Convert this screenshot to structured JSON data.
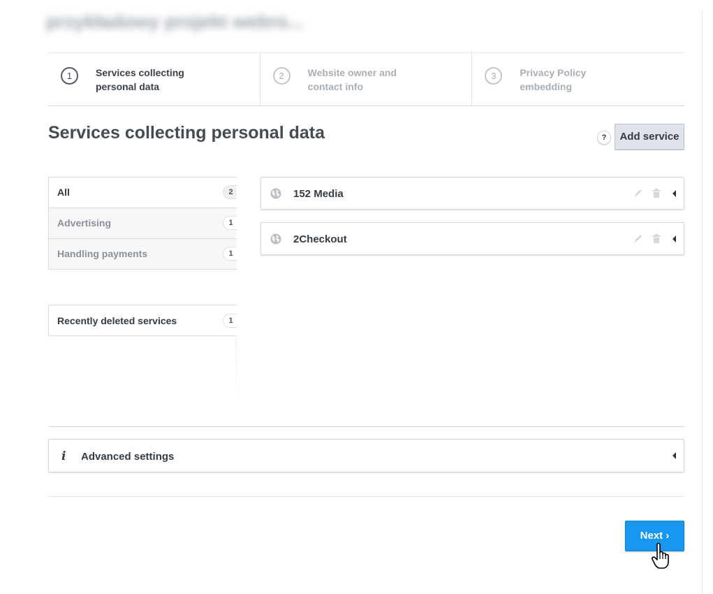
{
  "project": {
    "title": "przykładowy projekt webro..."
  },
  "steps": [
    {
      "number": "1",
      "label": "Services collecting personal data",
      "state": "active"
    },
    {
      "number": "2",
      "label": "Website owner and contact info",
      "state": "inactive"
    },
    {
      "number": "3",
      "label": "Privacy Policy embedding",
      "state": "inactive"
    }
  ],
  "page": {
    "heading": "Services collecting personal data",
    "help_label": "?",
    "add_service_label": "Add service"
  },
  "categories": [
    {
      "label": "All",
      "count": "2",
      "active": true
    },
    {
      "label": "Advertising",
      "count": "1",
      "active": false
    },
    {
      "label": "Handling payments",
      "count": "1",
      "active": false
    }
  ],
  "recently_deleted": {
    "label": "Recently deleted services",
    "count": "1"
  },
  "services": [
    {
      "name": "152 Media",
      "icon": "globe-icon"
    },
    {
      "name": "2Checkout",
      "icon": "globe-icon"
    }
  ],
  "advanced": {
    "icon": "info-icon",
    "glyph": "i",
    "label": "Advanced settings"
  },
  "footer": {
    "next_label": "Next ›"
  },
  "colors": {
    "primary": "#1797f0",
    "secondary_button": "#dfe4ea",
    "text": "#353b43",
    "muted_text": "#a9aeb5"
  }
}
